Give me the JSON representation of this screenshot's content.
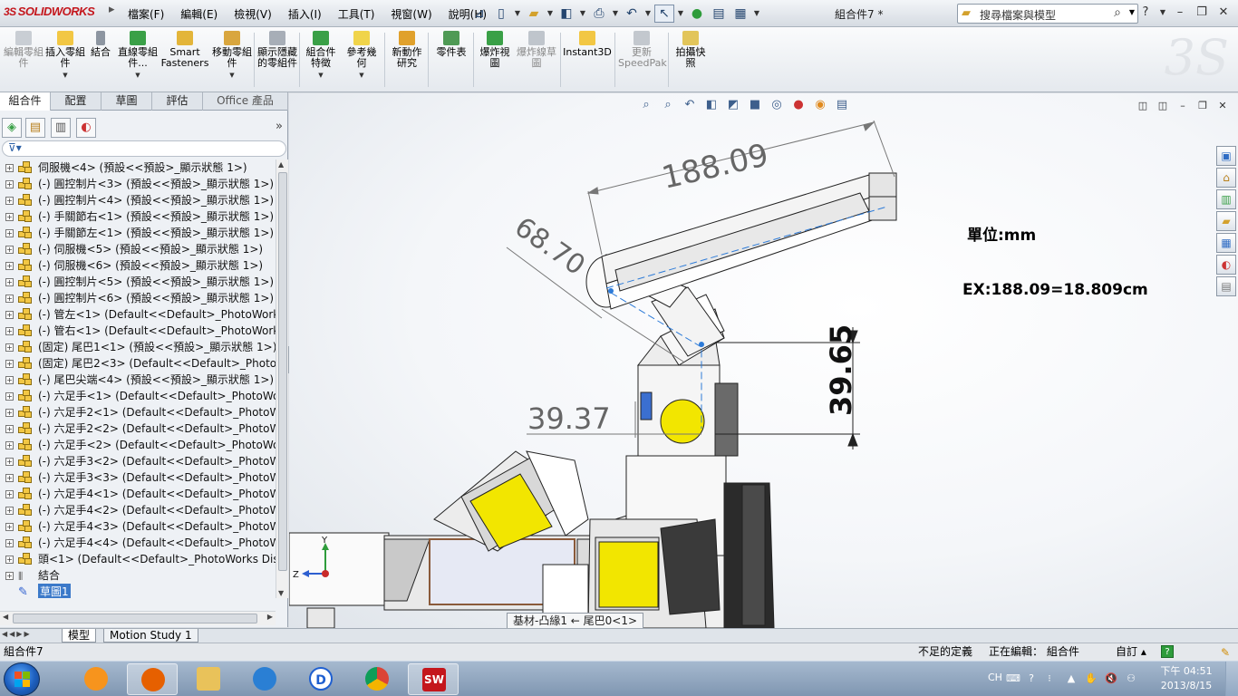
{
  "app": {
    "logo_text": "SOLIDWORKS",
    "document_title": "組合件7 *"
  },
  "menu": [
    "檔案(F)",
    "編輯(E)",
    "檢視(V)",
    "插入(I)",
    "工具(T)",
    "視窗(W)",
    "說明(H)"
  ],
  "search": {
    "placeholder": "搜尋檔案與模型"
  },
  "commands": [
    {
      "label": "編輯零組件",
      "disabled": true
    },
    {
      "label": "插入零組件",
      "disabled": false
    },
    {
      "label": "結合",
      "disabled": false
    },
    {
      "label": "直線零組件...",
      "disabled": false
    },
    {
      "label": "Smart Fasteners",
      "disabled": false
    },
    {
      "label": "移動零組件",
      "disabled": false
    },
    {
      "label": "顯示隱藏的零組件",
      "disabled": false
    },
    {
      "label": "組合件特徵",
      "disabled": false
    },
    {
      "label": "參考幾何",
      "disabled": false
    },
    {
      "label": "新動作研究",
      "disabled": false
    },
    {
      "label": "零件表",
      "disabled": false
    },
    {
      "label": "爆炸視圖",
      "disabled": false
    },
    {
      "label": "爆炸線草圖",
      "disabled": true
    },
    {
      "label": "Instant3D",
      "disabled": false
    },
    {
      "label": "更新SpeedPak",
      "disabled": true
    },
    {
      "label": "拍攝快照",
      "disabled": false
    }
  ],
  "tabs": [
    "組合件",
    "配置",
    "草圖",
    "評估",
    "Office 產品"
  ],
  "tree": [
    "伺服機<4> (預設<<預設>_顯示狀態 1>)",
    "(-) 圓控制片<3> (預設<<預設>_顯示狀態 1>)",
    "(-) 圓控制片<4> (預設<<預設>_顯示狀態 1>)",
    "(-) 手關節右<1> (預設<<預設>_顯示狀態 1>)",
    "(-) 手關節左<1> (預設<<預設>_顯示狀態 1>)",
    "(-) 伺服機<5> (預設<<預設>_顯示狀態 1>)",
    "(-) 伺服機<6> (預設<<預設>_顯示狀態 1>)",
    "(-) 圓控制片<5> (預設<<預設>_顯示狀態 1>)",
    "(-) 圓控制片<6> (預設<<預設>_顯示狀態 1>)",
    "(-) 管左<1> (Default<<Default>_PhotoWorks D",
    "(-) 管右<1> (Default<<Default>_PhotoWorks D",
    "(固定) 尾巴1<1> (預設<<預設>_顯示狀態 1>)",
    "(固定) 尾巴2<3> (Default<<Default>_PhotoWo",
    "(-) 尾巴尖端<4> (預設<<預設>_顯示狀態 1>)",
    "(-) 六足手<1> (Default<<Default>_PhotoWork",
    "(-) 六足手2<1> (Default<<Default>_PhotoWor",
    "(-) 六足手2<2> (Default<<Default>_PhotoWor",
    "(-) 六足手<2> (Default<<Default>_PhotoWork",
    "(-) 六足手3<2> (Default<<Default>_PhotoWor",
    "(-) 六足手3<3> (Default<<Default>_PhotoWor",
    "(-) 六足手4<1> (Default<<Default>_PhotoWor",
    "(-) 六足手4<2> (Default<<Default>_PhotoWor",
    "(-) 六足手4<3> (Default<<Default>_PhotoWor",
    "(-) 六足手4<4> (Default<<Default>_PhotoWor",
    "頭<1> (Default<<Default>_PhotoWorks Displa",
    "結合",
    "草圖1"
  ],
  "dimensions": {
    "d1": "188.09",
    "d2": "68.70",
    "d3": "39.65",
    "d4": "39.37"
  },
  "annotations": {
    "unit": "單位:mm",
    "example": "EX:188.09=18.809cm"
  },
  "triad": {
    "y": "Y",
    "z": "Z"
  },
  "tooltip": "基材-凸緣1 ← 尾巴0<1>",
  "bottom_tabs": [
    "模型",
    "Motion Study 1"
  ],
  "status": {
    "doc": "組合件7",
    "definition": "不足的定義",
    "editing": "正在編輯： 組合件",
    "custom": "自訂 ▴"
  },
  "tray": {
    "lang": "CH",
    "time": "下午 04:51",
    "date": "2013/8/15"
  },
  "colors": {
    "brand_red": "#c4161c",
    "selection_blue": "#3b79c9",
    "part_yellow": "#f2e600",
    "dimension_gray": "#666666"
  }
}
